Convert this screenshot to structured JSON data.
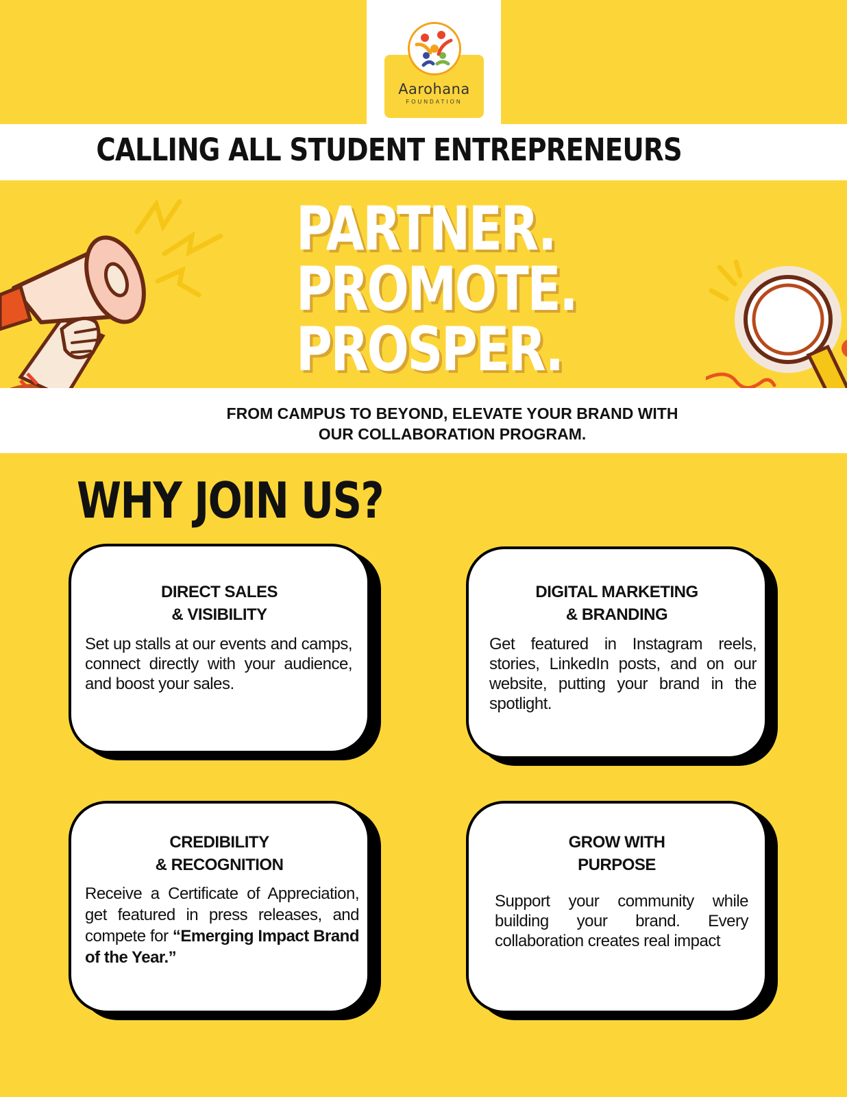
{
  "logo": {
    "name": "Aarohana",
    "tagline": "FOUNDATION"
  },
  "headline": "CALLING ALL STUDENT ENTREPRENEURS",
  "hero": {
    "line1": "PARTNER.",
    "line2": "PROMOTE.",
    "line3": "PROSPER."
  },
  "subtitle": {
    "line1": "FROM CAMPUS TO BEYOND, ELEVATE YOUR BRAND WITH",
    "line2": "OUR COLLABORATION PROGRAM."
  },
  "section_title": "WHY JOIN US?",
  "cards": [
    {
      "title1": "DIRECT SALES",
      "title2": "& VISIBILITY",
      "body": "Set up stalls at our events and camps, connect directly with your audience, and boost your sales."
    },
    {
      "title1": "DIGITAL MARKETING",
      "title2": "& BRANDING",
      "body": "Get featured in Instagram reels, stories, LinkedIn posts, and on our website, putting your brand in the spotlight."
    },
    {
      "title1": "CREDIBILITY",
      "title2": "& RECOGNITION",
      "body_pre": "Receive a Certificate of Appreciation, get featured in press releases, and compete for ",
      "body_bold": "“Emerging Impact Brand of the Year.”"
    },
    {
      "title1": "GROW WITH",
      "title2": "PURPOSE",
      "body": "Support your community while building your brand. Every collaboration creates real impact"
    }
  ],
  "icons": [
    "megaphone-icon",
    "magnifier-icon",
    "lightning-icon",
    "logo-people-icon"
  ],
  "colors": {
    "background": "#fcd638",
    "text": "#111111",
    "accent": "#d9a531",
    "white": "#ffffff"
  }
}
